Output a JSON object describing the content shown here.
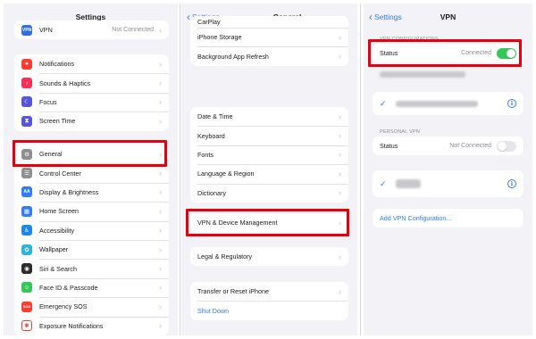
{
  "settings": {
    "title": "Settings",
    "vpn_row": {
      "label": "VPN",
      "value": "Not Connected",
      "icon": "vpn-icon",
      "color": "#2f6fe0"
    },
    "groups": [
      [
        {
          "label": "Notifications",
          "icon": "bell-icon",
          "color": "#ff3b30"
        },
        {
          "label": "Sounds & Haptics",
          "icon": "speaker-icon",
          "color": "#ff2d55"
        },
        {
          "label": "Focus",
          "icon": "moon-icon",
          "color": "#5856d6"
        },
        {
          "label": "Screen Time",
          "icon": "hourglass-icon",
          "color": "#5856d6"
        }
      ],
      [
        {
          "label": "General",
          "icon": "gear-icon",
          "color": "#8e8e93"
        },
        {
          "label": "Control Center",
          "icon": "control-center-icon",
          "color": "#8e8e93"
        },
        {
          "label": "Display & Brightness",
          "icon": "brightness-icon",
          "color": "#2f7cf6"
        },
        {
          "label": "Home Screen",
          "icon": "home-screen-icon",
          "color": "#2f7cf6"
        },
        {
          "label": "Accessibility",
          "icon": "accessibility-icon",
          "color": "#1e88e5"
        },
        {
          "label": "Wallpaper",
          "icon": "wallpaper-icon",
          "color": "#2fb6d6"
        },
        {
          "label": "Siri & Search",
          "icon": "siri-icon",
          "color": "#2c2c2e"
        },
        {
          "label": "Face ID & Passcode",
          "icon": "face-id-icon",
          "color": "#34c759"
        },
        {
          "label": "Emergency SOS",
          "icon": "sos-icon",
          "color": "#ff3b30"
        },
        {
          "label": "Exposure Notifications",
          "icon": "exposure-icon",
          "color": "#ff3b30"
        }
      ]
    ],
    "icon_glyphs": [
      "N",
      "♪",
      "☾",
      "⧗",
      "⚙",
      "☰",
      "AA",
      "▦",
      "♿",
      "✿",
      "◉",
      "☺",
      "SOS",
      "✱"
    ]
  },
  "general": {
    "back_label": "Settings",
    "title": "General",
    "groups": [
      [
        "CarPlay",
        "iPhone Storage",
        "Background App Refresh"
      ],
      [
        "Date & Time",
        "Keyboard",
        "Fonts",
        "Language & Region",
        "Dictionary"
      ],
      [
        "VPN & Device Management"
      ],
      [
        "Legal & Regulatory"
      ],
      [
        "Transfer or Reset iPhone",
        "Shut Down"
      ]
    ]
  },
  "vpn": {
    "back_label": "Settings",
    "title": "VPN",
    "vpn_configurations_header": "VPN CONFIGURATIONS",
    "status_label": "Status",
    "status_value": "Connected",
    "status_on": true,
    "personal_vpn_header": "PERSONAL VPN",
    "personal_status_label": "Status",
    "personal_status_value": "Not Connected",
    "personal_status_on": false,
    "add_configuration": "Add VPN Configuration..."
  },
  "colors": {
    "accent": "#2f7cf6",
    "highlight": "#e3000f",
    "toggle_on": "#34c759"
  }
}
